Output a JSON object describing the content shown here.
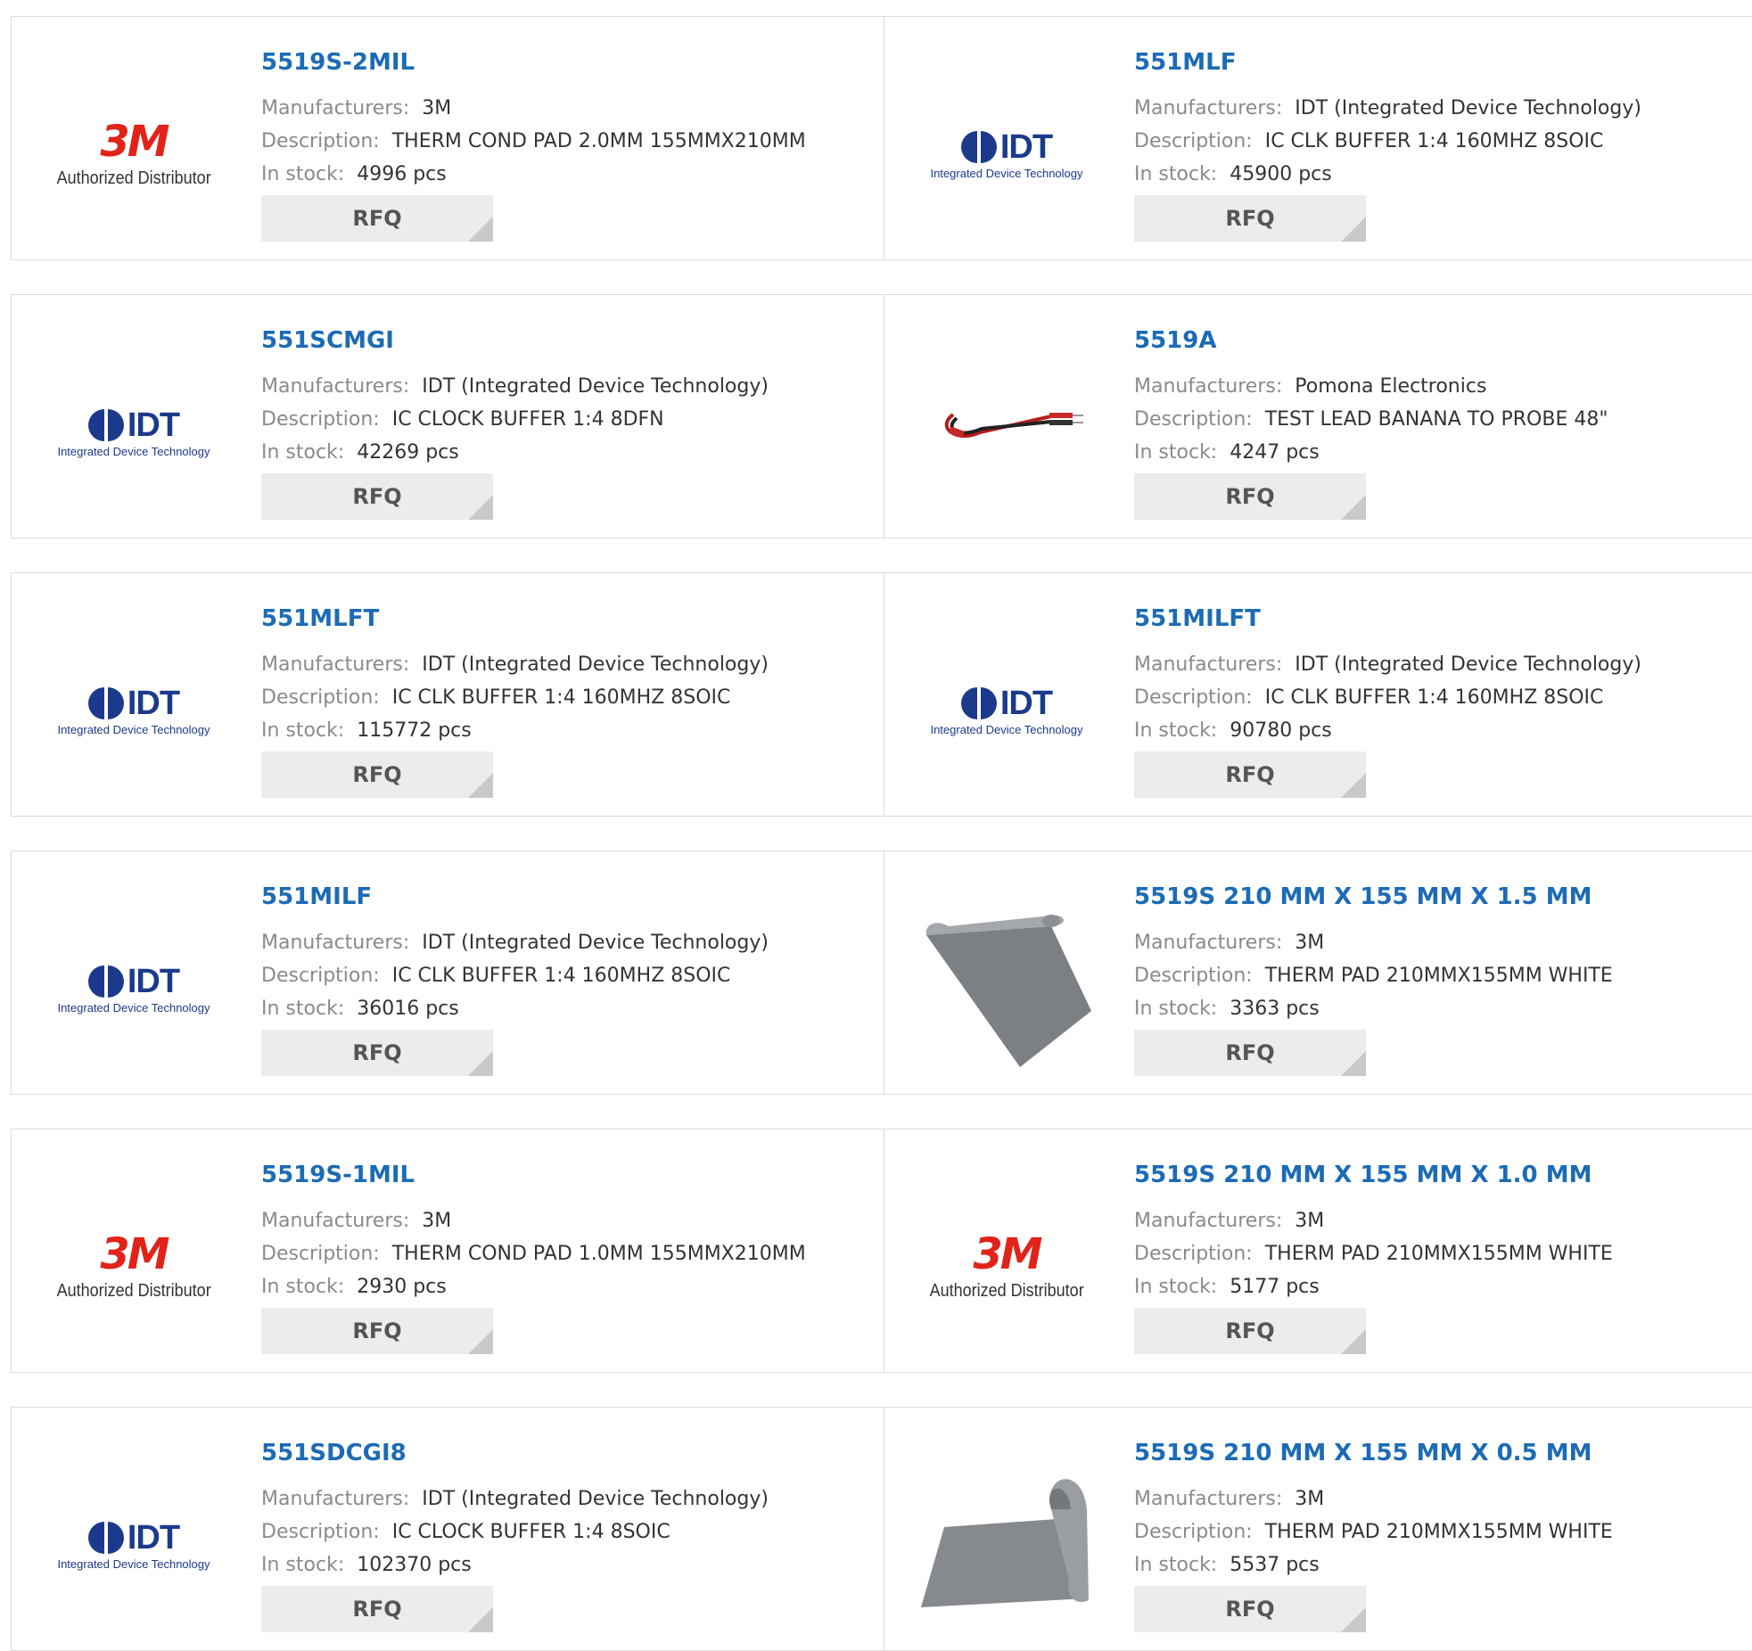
{
  "labels": {
    "manufacturers": "Manufacturers:",
    "description": "Description:",
    "in_stock": "In stock:",
    "rfq": "RFQ",
    "pcs": "pcs"
  },
  "logos": {
    "3m": {
      "mark": "3M",
      "sub": "Authorized Distributor",
      "color": "#e2231a"
    },
    "idt": {
      "mark": "IDT",
      "sub": "Integrated Device Technology",
      "color": "#1c3a8c"
    }
  },
  "rows": [
    [
      {
        "pn": "5519S-2MIL",
        "mfr": "3M",
        "desc": "THERM COND PAD 2.0MM 155MMX210MM",
        "stock": "4996 pcs",
        "logo": "3m"
      },
      {
        "pn": "551MLF",
        "mfr": "IDT (Integrated Device Technology)",
        "desc": "IC CLK BUFFER 1:4 160MHZ 8SOIC",
        "stock": "45900 pcs",
        "logo": "idt"
      }
    ],
    [
      {
        "pn": "551SCMGI",
        "mfr": "IDT (Integrated Device Technology)",
        "desc": "IC CLOCK BUFFER 1:4 8DFN",
        "stock": "42269 pcs",
        "logo": "idt"
      },
      {
        "pn": "5519A",
        "mfr": "Pomona Electronics",
        "desc": "TEST LEAD BANANA TO PROBE 48\"",
        "stock": "4247 pcs",
        "logo": "test-lead"
      }
    ],
    [
      {
        "pn": "551MLFT",
        "mfr": "IDT (Integrated Device Technology)",
        "desc": "IC CLK BUFFER 1:4 160MHZ 8SOIC",
        "stock": "115772 pcs",
        "logo": "idt"
      },
      {
        "pn": "551MILFT",
        "mfr": "IDT (Integrated Device Technology)",
        "desc": "IC CLK BUFFER 1:4 160MHZ 8SOIC",
        "stock": "90780 pcs",
        "logo": "idt"
      }
    ],
    [
      {
        "pn": "551MILF",
        "mfr": "IDT (Integrated Device Technology)",
        "desc": "IC CLK BUFFER 1:4 160MHZ 8SOIC",
        "stock": "36016 pcs",
        "logo": "idt"
      },
      {
        "pn": "5519S 210 MM X 155 MM X 1.5 MM",
        "mfr": "3M",
        "desc": "THERM PAD 210MMX155MM WHITE",
        "stock": "3363 pcs",
        "logo": "thermal-pad"
      }
    ],
    [
      {
        "pn": "5519S-1MIL",
        "mfr": "3M",
        "desc": "THERM COND PAD 1.0MM 155MMX210MM",
        "stock": "2930 pcs",
        "logo": "3m"
      },
      {
        "pn": "5519S 210 MM X 155 MM X 1.0 MM",
        "mfr": "3M",
        "desc": "THERM PAD 210MMX155MM WHITE",
        "stock": "5177 pcs",
        "logo": "3m"
      }
    ],
    [
      {
        "pn": "551SDCGI8",
        "mfr": "IDT (Integrated Device Technology)",
        "desc": "IC CLOCK BUFFER 1:4 8SOIC",
        "stock": "102370 pcs",
        "logo": "idt"
      },
      {
        "pn": "5519S 210 MM X 155 MM X 0.5 MM",
        "mfr": "3M",
        "desc": "THERM PAD 210MMX155MM WHITE",
        "stock": "5537 pcs",
        "logo": "thermal-pad-roll"
      }
    ]
  ]
}
